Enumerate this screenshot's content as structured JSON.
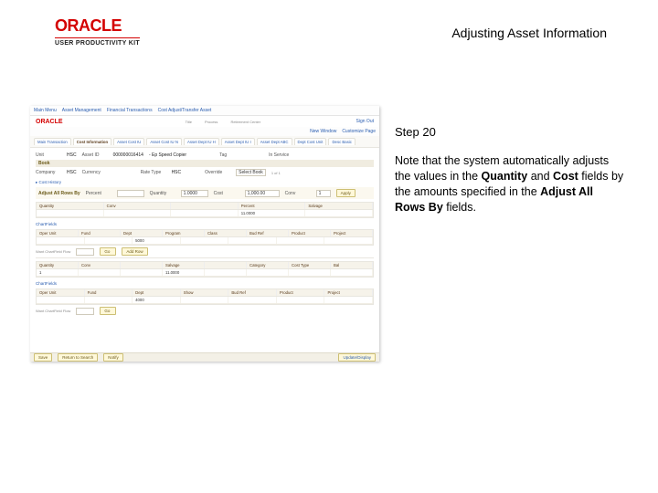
{
  "logo": {
    "brand": "ORACLE",
    "sub": "USER PRODUCTIVITY KIT"
  },
  "doc_title": "Adjusting Asset Information",
  "step_label": "Step 20",
  "note": {
    "t1": "Note that the system automatically adjusts the values in the ",
    "b1": "Quantity",
    "t2": " and ",
    "b2": "Cost",
    "t3": " fields by the amounts specified in the ",
    "b3": "Adjust All Rows By",
    "t4": " fields."
  },
  "shot": {
    "brand": "ORACLE",
    "signout": "Sign Out",
    "crumbs": [
      "Main Menu",
      "Asset Management",
      "Financial Transactions",
      "Cost Adjust/Transfer Asset"
    ],
    "menu": [
      "Title",
      "Process",
      "Retirement Center"
    ],
    "newwindow": "New Window",
    "custpage": "Customize Page",
    "tabs": [
      "Main Transaction",
      "Cost Information",
      "Asset Cost IU",
      "Asset Cost IU N",
      "Asset Dept IU H",
      "Asset Dept IU I",
      "Asset Dept ABC",
      "Dept Cost Unit",
      "Desc Basic"
    ],
    "active_tab": 1,
    "line1": {
      "unit_l": "Unit",
      "unit_v": "HSC",
      "asset_l": "Asset ID",
      "asset_v": "000000016414",
      "desc_v": "- Ep Speed Copier",
      "tag_l": "Tag",
      "inserv_l": "In Service"
    },
    "book": {
      "hdr": "Book",
      "comp_l": "Company",
      "comp_v": "HSC",
      "curr_l": "Currency",
      "rate_l": "Rate Type",
      "rate_v": "HSC",
      "override_l": "Override",
      "select_l": "Select Book",
      "select_v": "1",
      "of": "of",
      "total": "1"
    },
    "costhist": "Cost History",
    "adjrow": {
      "title": "Adjust All Rows By",
      "pct_l": "Percent",
      "qty_l": "Quantity",
      "qty_v": "1.0000",
      "cost_l": "Cost",
      "cost_v": "1,000.00",
      "conv_l": "Conv",
      "conv_v": "1",
      "apply": "Apply"
    },
    "grid1": {
      "h": [
        "Quantity",
        "Conv",
        "",
        "Percent",
        "Salvage"
      ],
      "r": [
        "",
        "",
        "",
        "11.0000",
        ""
      ]
    },
    "chart_l": "ChartFields",
    "grid2": {
      "h": [
        "Oper Unit",
        "Fund",
        "Dept",
        "Program",
        "Class",
        "Bud Ref",
        "Product",
        "Project"
      ],
      "r": [
        "",
        "",
        "5000",
        "",
        "",
        "",
        ""
      ]
    },
    "wip": "Want ChartField Flow",
    "go": "Go",
    "addrow": "Add Row",
    "grid3": {
      "h": [
        "Quantity",
        "Conv",
        "",
        "Salvage",
        "",
        "Category",
        "Cost Type",
        "Bal"
      ],
      "r": [
        "1",
        "",
        "",
        "11.0000",
        "",
        "",
        "",
        ""
      ]
    },
    "grid4": {
      "h": [
        "Oper Unit",
        "Fund",
        "Dept",
        "Show",
        "Bud Ref",
        "Product",
        "Project"
      ],
      "r": [
        "",
        "",
        "4000",
        "",
        "",
        "",
        ""
      ]
    },
    "foot": [
      "Save",
      "Return to Search",
      "Notify",
      "Update/Display"
    ]
  }
}
